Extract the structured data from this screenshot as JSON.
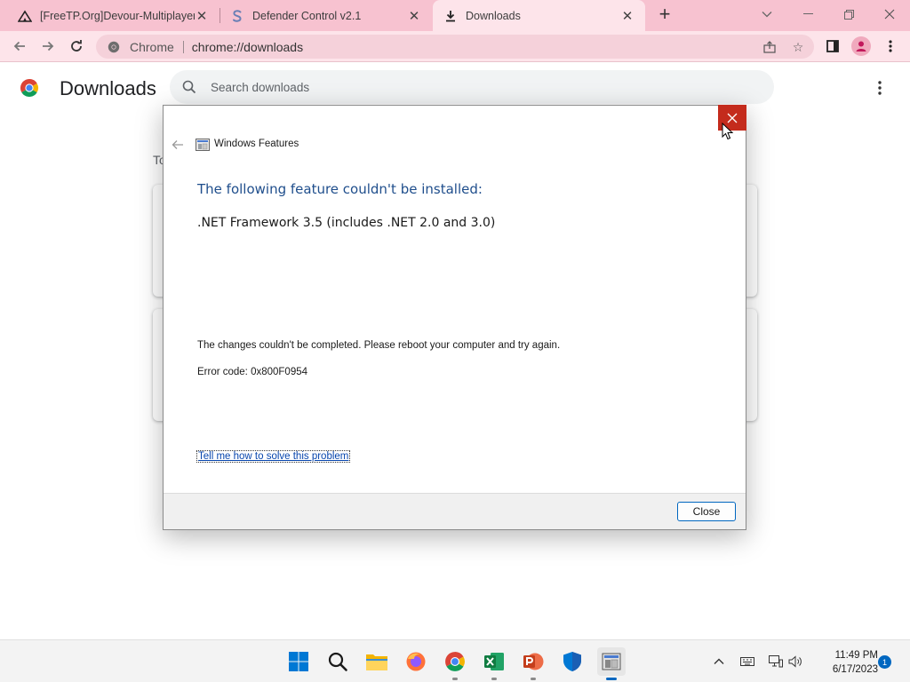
{
  "browser": {
    "tabs": [
      {
        "title": "[FreeTP.Org]Devour-Multiplayer",
        "icon": "freetp-icon",
        "active": false
      },
      {
        "title": "Defender Control v2.1",
        "icon": "defender-control-icon",
        "active": false
      },
      {
        "title": "Downloads",
        "icon": "download-icon",
        "active": true
      }
    ],
    "new_tab_icon": "plus-icon",
    "omnibox": {
      "site_label": "Chrome",
      "url": "chrome://downloads"
    },
    "colors": {
      "tabstrip": "#f7c2d0",
      "toolbar": "#fde4ea",
      "omnibox": "#f5d1da"
    }
  },
  "downloads_page": {
    "title": "Downloads",
    "search_placeholder": "Search downloads",
    "section_label": "To"
  },
  "dialog": {
    "app_title": "Windows Features",
    "heading": "The following feature couldn't be installed:",
    "feature": ".NET Framework 3.5 (includes .NET 2.0 and 3.0)",
    "message": "The changes couldn't be completed. Please reboot your computer and try again.",
    "error_code": "Error code: 0x800F0954",
    "help_link": "Tell me how to solve this problem",
    "close_button": "Close",
    "colors": {
      "heading": "#1f4e8c",
      "close_x_bg": "#c42b1c"
    }
  },
  "taskbar": {
    "apps": [
      "windows-start-icon",
      "search-icon",
      "file-explorer-icon",
      "firefox-icon",
      "chrome-icon",
      "excel-icon",
      "powerpoint-icon",
      "windows-security-icon",
      "windows-features-icon"
    ],
    "clock": {
      "time": "11:49 PM",
      "date": "6/17/2023"
    },
    "notification_count": "1"
  }
}
